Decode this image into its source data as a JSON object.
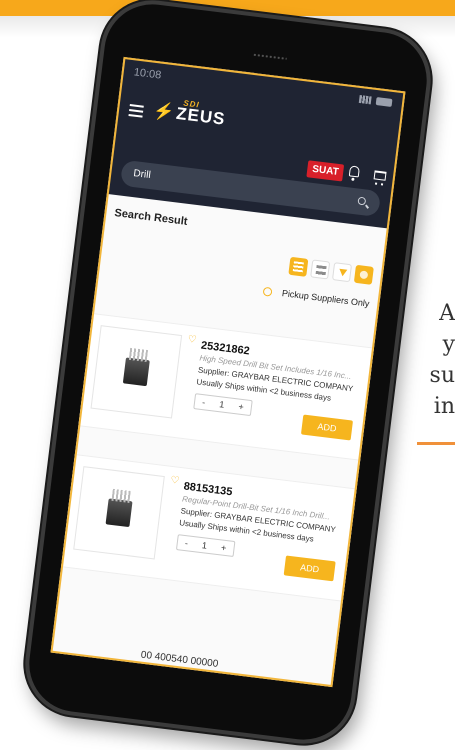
{
  "side_text": {
    "line1": "A",
    "line2": "y",
    "line3": "su",
    "line4": "in"
  },
  "phone": {
    "status_time": "10:08",
    "logo_text": "ZEUS",
    "logo_super": "SDI",
    "user_badge": "SUAT",
    "search_value": "Drill",
    "results_title": "Search Result",
    "pickup_label": "Pickup Suppliers Only",
    "products": [
      {
        "id": "25321862",
        "description": "High Speed Drill Bit Set Includes  1/16 Inc...",
        "supplier": "Supplier: GRAYBAR ELECTRIC COMPANY",
        "shipping": "Usually Ships within <2 business days",
        "qty": "1",
        "add_label": "ADD"
      },
      {
        "id": "88153135",
        "description": "Regular-Point Drill-Bit Set  1/16 Inch Drill...",
        "supplier": "Supplier: GRAYBAR ELECTRIC COMPANY",
        "shipping": "Usually Ships within <2 business days",
        "qty": "1",
        "add_label": "ADD"
      }
    ],
    "qty_minus": "-",
    "qty_plus": "+",
    "next_item_partial": "00 400540 00000"
  },
  "colors": {
    "accent": "#f6b51e",
    "header_dark": "#1f2433",
    "badge_red": "#d8202a"
  }
}
